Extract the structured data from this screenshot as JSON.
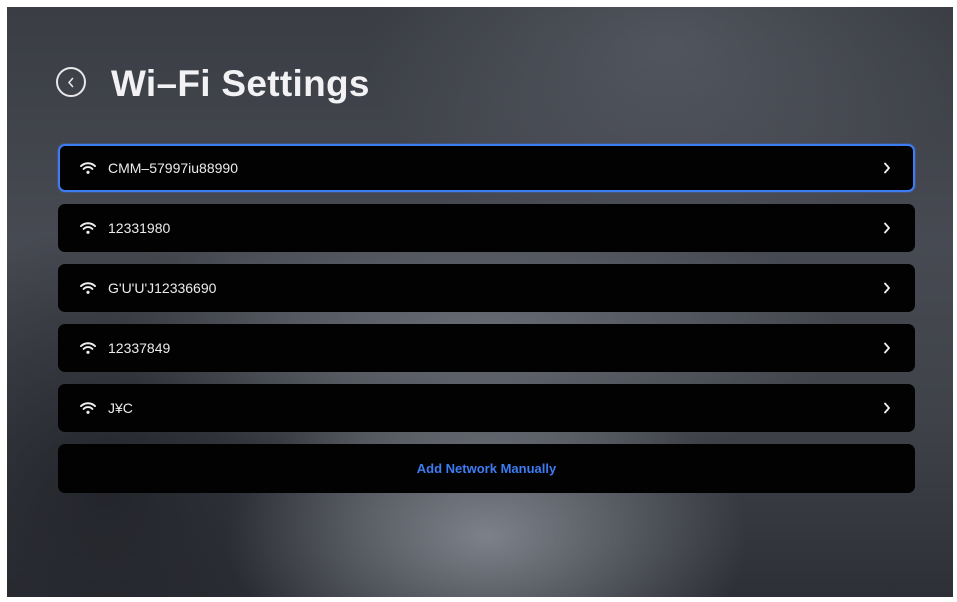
{
  "header": {
    "title": "Wi–Fi Settings",
    "back_icon": "chevron-left-icon"
  },
  "networks": [
    {
      "name": "CMM–57997iu88990",
      "icon": "wifi-icon",
      "selected": true
    },
    {
      "name": "12331980",
      "icon": "wifi-icon",
      "selected": false
    },
    {
      "name": "G'U'U'J12336690",
      "icon": "wifi-icon",
      "selected": false
    },
    {
      "name": "12337849",
      "icon": "wifi-icon",
      "selected": false
    },
    {
      "name": "J¥C",
      "icon": "wifi-icon",
      "selected": false
    }
  ],
  "add_network": {
    "label": "Add Network Manually"
  },
  "colors": {
    "accent": "#3d7cf2",
    "row_background": "#020203",
    "text": "#ececee"
  }
}
